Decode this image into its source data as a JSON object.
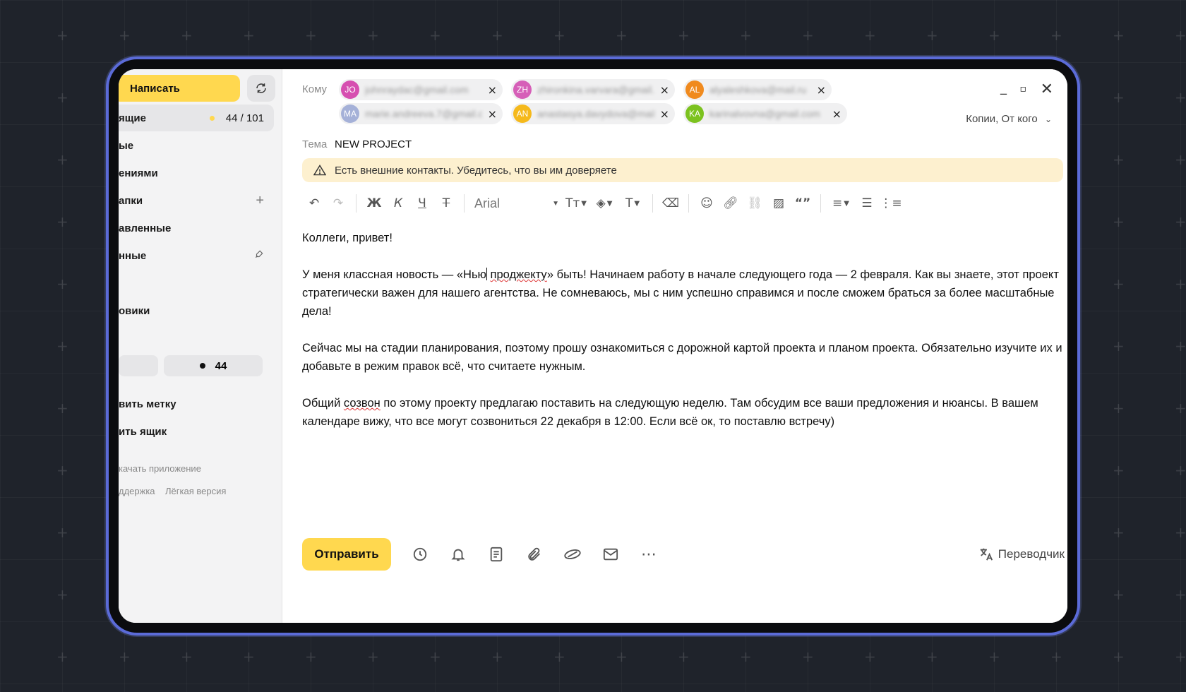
{
  "sidebar": {
    "write_label": "Написать",
    "items": [
      {
        "label": "ящие",
        "count": "44 / 101"
      },
      {
        "label": "ые"
      },
      {
        "label": "ениями"
      },
      {
        "label": "апки"
      },
      {
        "label": "авленные"
      },
      {
        "label": "нные"
      },
      {
        "label": "овики"
      }
    ],
    "unread_pill": "44",
    "add_label": "вить метку",
    "add_mailbox": "ить ящик",
    "download_app": "качать приложение",
    "support": "ддержка",
    "light_version": "Лёгкая версия"
  },
  "compose": {
    "to_label": "Кому",
    "recipients": [
      {
        "initials": "JO",
        "email": "johnraydac@gmail.com",
        "color": "#d64fb0"
      },
      {
        "initials": "ZH",
        "email": "zhironkina.varvara@gmail.com",
        "color": "#d65fb8"
      },
      {
        "initials": "AL",
        "email": "alyaleshkova@mail.ru",
        "color": "#f08a1e"
      },
      {
        "initials": "MA",
        "email": "marie.andreeva.7@gmail.com",
        "color": "#a5b1d8"
      },
      {
        "initials": "AN",
        "email": "anastasya.davydova@mail.ru",
        "color": "#f5b91c"
      },
      {
        "initials": "KA",
        "email": "karinalvovna@gmail.com",
        "color": "#7cc21f"
      }
    ],
    "cc_from": "Копии, От кого",
    "subject_label": "Тема",
    "subject": "NEW PROJECT",
    "warning": "Есть внешние контакты. Убедитесь, что вы им доверяете",
    "font": "Arial",
    "body": {
      "greeting": "Коллеги, привет!",
      "p1_a": "У меня классная новость — «Нью",
      "p1_b": "проджекту",
      "p1_c": "» быть! Начинаем работу в начале следующего года — 2 февраля. Как вы знаете, этот проект стратегически важен для нашего агентства. Не сомневаюсь, мы с ним успешно справимся и после сможем браться за более масштабные дела!",
      "p2": "Сейчас мы на стадии планирования, поэтому прошу ознакомиться с дорожной картой проекта и планом проекта. Обязательно изучите их и добавьте в режим правок всё, что считаете нужным.",
      "p3_a": "Общий",
      "p3_b": "созвон",
      "p3_c": "по этому проекту предлагаю поставить на следующую неделю. Там обсудим все ваши предложения и нюансы. В вашем календаре вижу, что все могут созвониться 22 декабря в 12:00. Если всё ок, то поставлю встречу)"
    },
    "send_label": "Отправить",
    "translator_label": "Переводчик"
  },
  "colors": {
    "accent": "#ffd84f",
    "frame": "#5b6bd8",
    "warning_bg": "#fdf0cf"
  }
}
